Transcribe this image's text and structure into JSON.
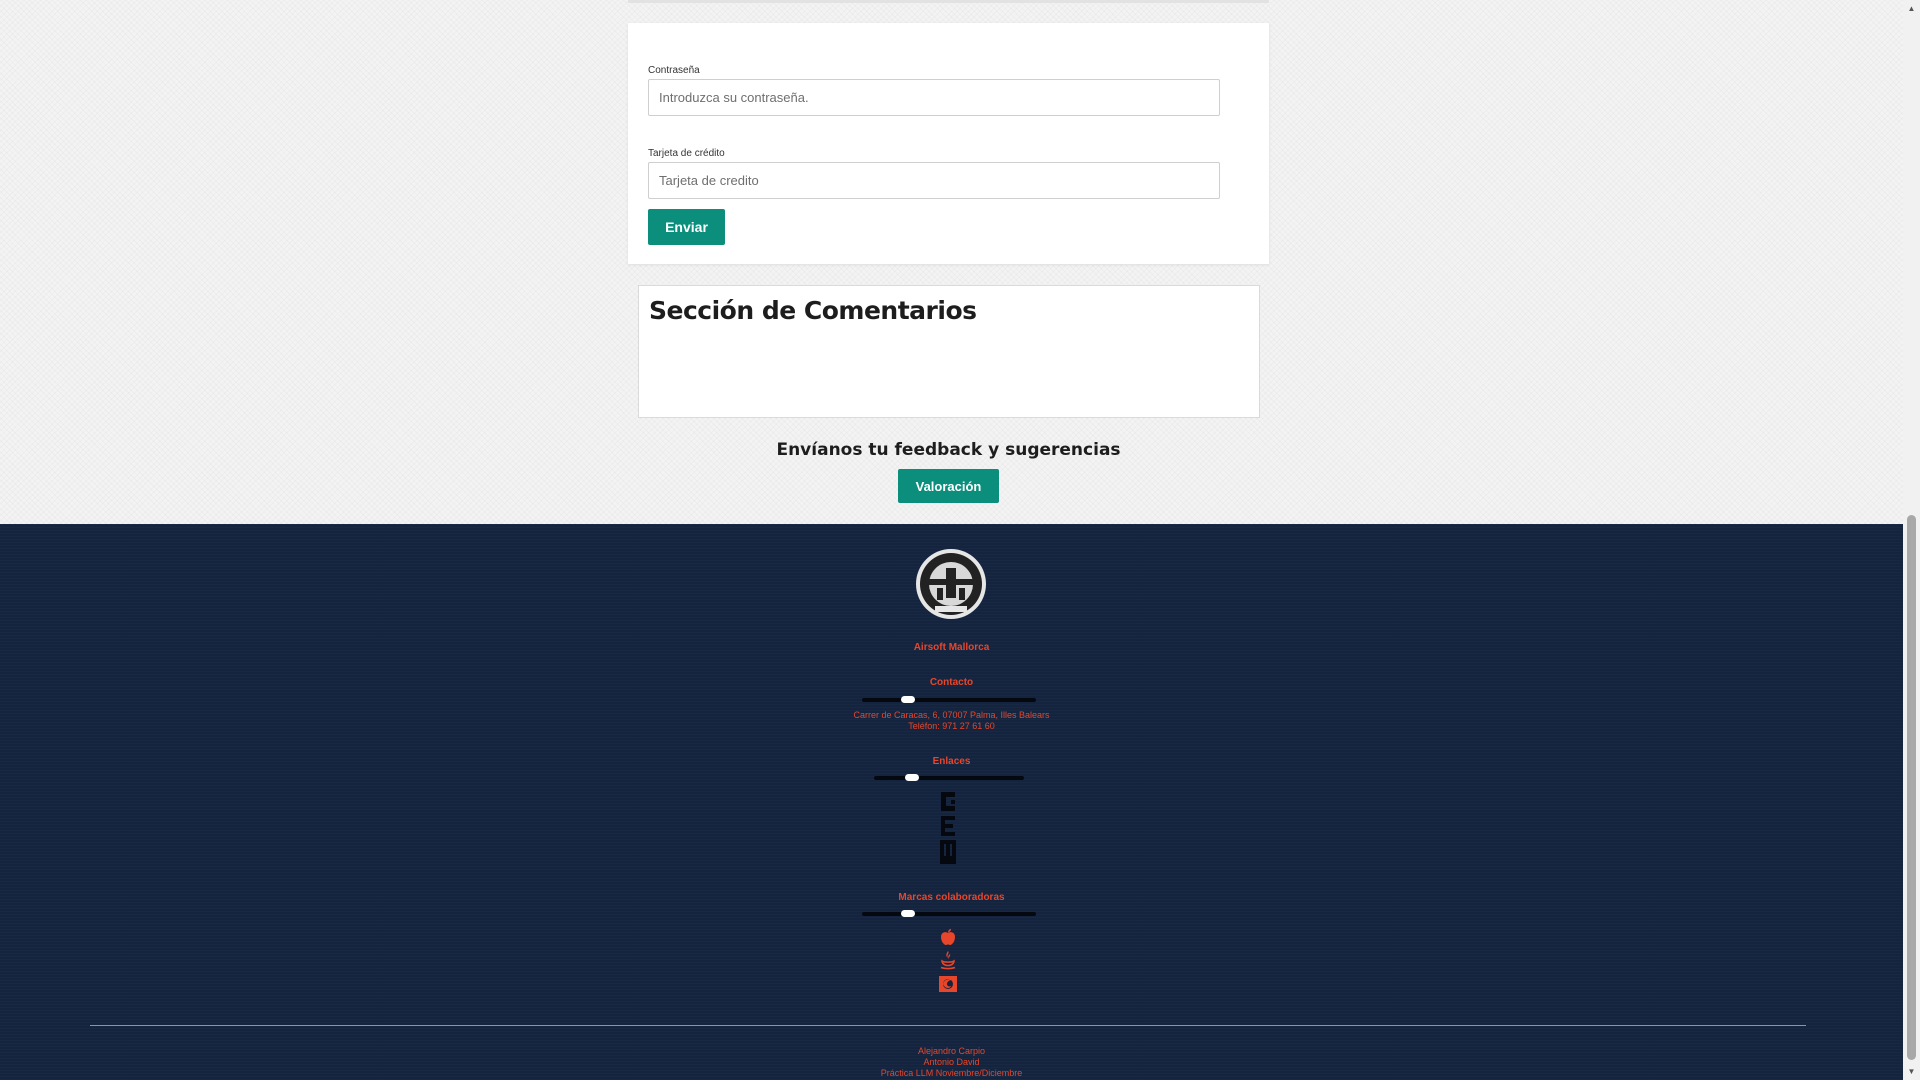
{
  "form": {
    "password_label": "Contraseña",
    "password_placeholder": "Introduzca su contraseña.",
    "card_label": "Tarjeta de crédito",
    "card_placeholder": "Tarjeta de credito",
    "submit_label": "Enviar"
  },
  "comments": {
    "title": "Sección de Comentarios"
  },
  "feedback": {
    "title": "Envíanos tu feedback y sugerencias",
    "button_label": "Valoración"
  },
  "footer": {
    "logo_icon": "airsoft-club-logo-icon",
    "brand_name": "Airsoft Mallorca",
    "contact_heading": "Contacto",
    "address": "Carrer de Caracas, 6, 07007 Palma, Illes Balears",
    "phone": "Teléfon: 971 27 61 60",
    "links_heading": "Enlaces",
    "partners_heading": "Marcas colaboradoras",
    "partner_icons": [
      "apple-icon",
      "java-icon",
      "firefox-icon"
    ],
    "credits": [
      "Alejandro Carpio",
      "Antonio David",
      "Práctica LLM Noviembre/Diciembre"
    ],
    "accent_color": "#e8462a",
    "background_color": "#14243f"
  },
  "colors": {
    "button": "#0b8f7c"
  }
}
